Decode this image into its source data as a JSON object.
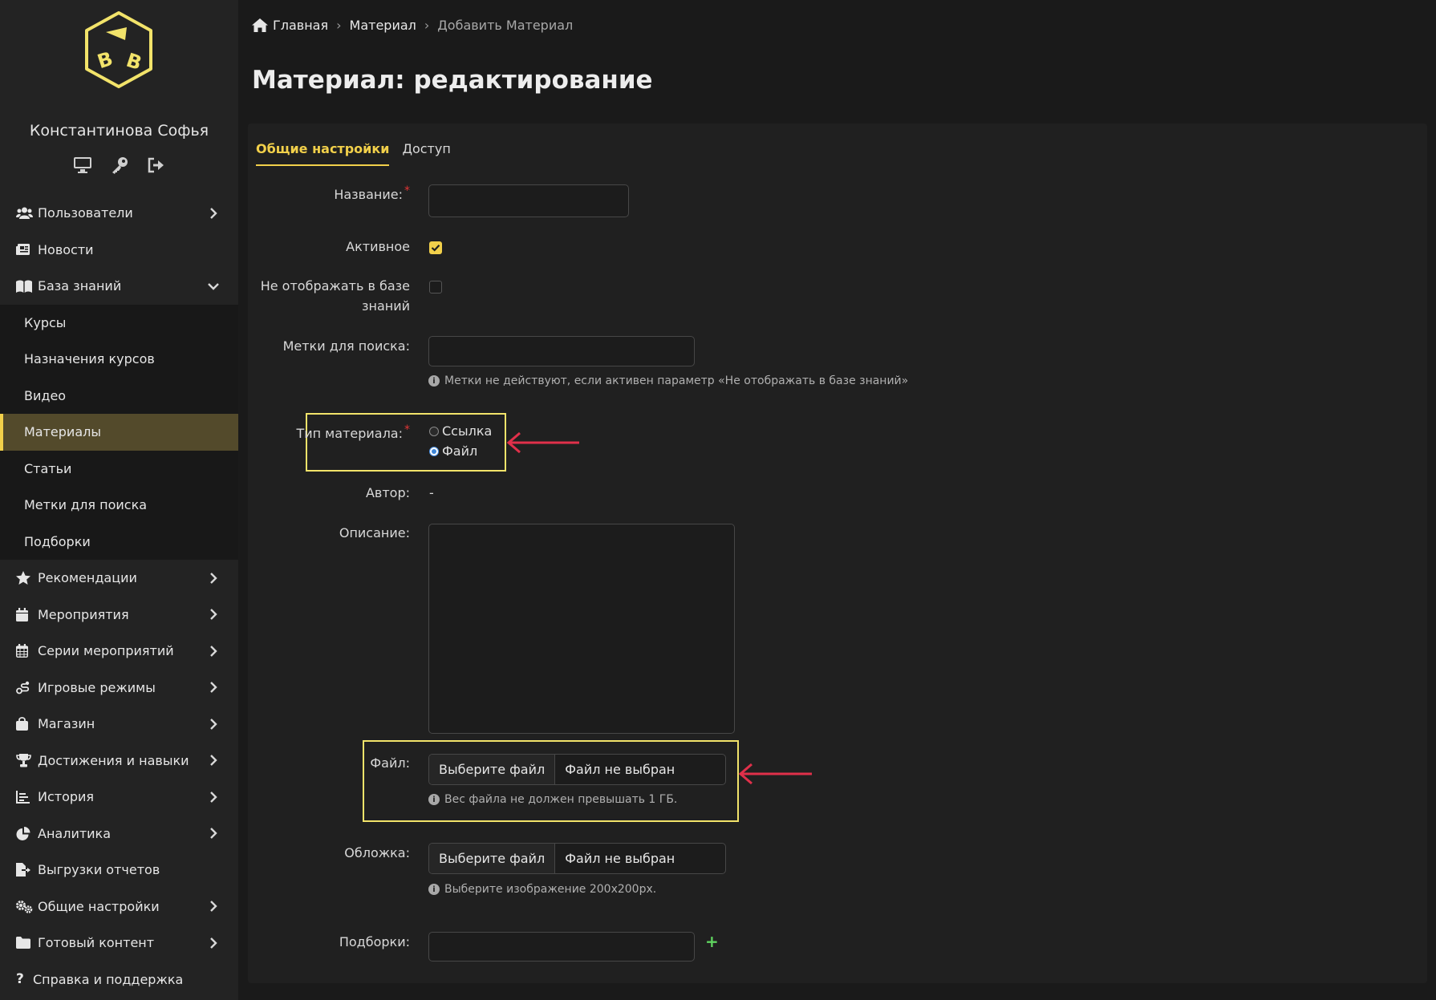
{
  "sidebar": {
    "user_name": "Константинова Софья",
    "user_icons": [
      "monitor-icon",
      "key-icon",
      "logout-icon"
    ],
    "items": [
      {
        "label": "Пользователи",
        "icon": "users-icon",
        "chevron": "right"
      },
      {
        "label": "Новости",
        "icon": "newspaper-icon"
      },
      {
        "label": "База знаний",
        "icon": "book-icon",
        "chevron": "down"
      },
      {
        "label": "Рекомендации",
        "icon": "star-icon",
        "chevron": "right"
      },
      {
        "label": "Мероприятия",
        "icon": "calendar-icon",
        "chevron": "right"
      },
      {
        "label": "Серии мероприятий",
        "icon": "calendar-grid-icon",
        "chevron": "right"
      },
      {
        "label": "Игровые режимы",
        "icon": "route-icon",
        "chevron": "right"
      },
      {
        "label": "Магазин",
        "icon": "bag-icon",
        "chevron": "right"
      },
      {
        "label": "Достижения и навыки",
        "icon": "trophy-icon",
        "chevron": "right"
      },
      {
        "label": "История",
        "icon": "chart-line-icon",
        "chevron": "right"
      },
      {
        "label": "Аналитика",
        "icon": "pie-chart-icon",
        "chevron": "right"
      },
      {
        "label": "Выгрузки отчетов",
        "icon": "file-export-icon"
      },
      {
        "label": "Общие настройки",
        "icon": "gears-icon",
        "chevron": "right"
      },
      {
        "label": "Готовый контент",
        "icon": "folder-icon",
        "chevron": "right"
      },
      {
        "label": "Справка и поддержка",
        "icon": "question-icon"
      }
    ],
    "submenu": [
      {
        "label": "Курсы"
      },
      {
        "label": "Назначения курсов"
      },
      {
        "label": "Видео"
      },
      {
        "label": "Материалы",
        "active": true
      },
      {
        "label": "Статьи"
      },
      {
        "label": "Метки для поиска"
      },
      {
        "label": "Подборки"
      }
    ]
  },
  "breadcrumb": {
    "home": "Главная",
    "section": "Материал",
    "current": "Добавить Материал",
    "separator": "›"
  },
  "page_title": "Материал: редактирование",
  "tabs": [
    {
      "label": "Общие настройки",
      "active": true
    },
    {
      "label": "Доступ"
    }
  ],
  "form": {
    "name_label": "Название:",
    "required_mark": "*",
    "active_label": "Активное",
    "active_checked": true,
    "hide_label_line1": "Не отображать в базе",
    "hide_label_line2": "знаний",
    "hide_checked": false,
    "tags_label": "Метки для поиска:",
    "tags_hint": "Метки не действуют, если активен параметр «Не отображать в базе знаний»",
    "type_label": "Тип материала:",
    "type_options": [
      {
        "label": "Ссылка",
        "selected": false
      },
      {
        "label": "Файл",
        "selected": true
      }
    ],
    "author_label": "Автор:",
    "author_value": "-",
    "description_label": "Описание:",
    "file_label": "Файл:",
    "file_button": "Выберите файл",
    "file_none": "Файл не выбран",
    "file_hint": "Вес файла не должен превышать 1 ГБ.",
    "cover_label": "Обложка:",
    "cover_button": "Выберите файл",
    "cover_none": "Файл не выбран",
    "cover_hint": "Выберите изображение 200x200px.",
    "collections_label": "Подборки:",
    "add_symbol": "+",
    "info_symbol": "i"
  },
  "colors": {
    "accent": "#f2d04a",
    "highlight_box": "#f2e36a",
    "arrow": "#e0304a",
    "required": "#e03535",
    "add": "#5fd35f"
  }
}
